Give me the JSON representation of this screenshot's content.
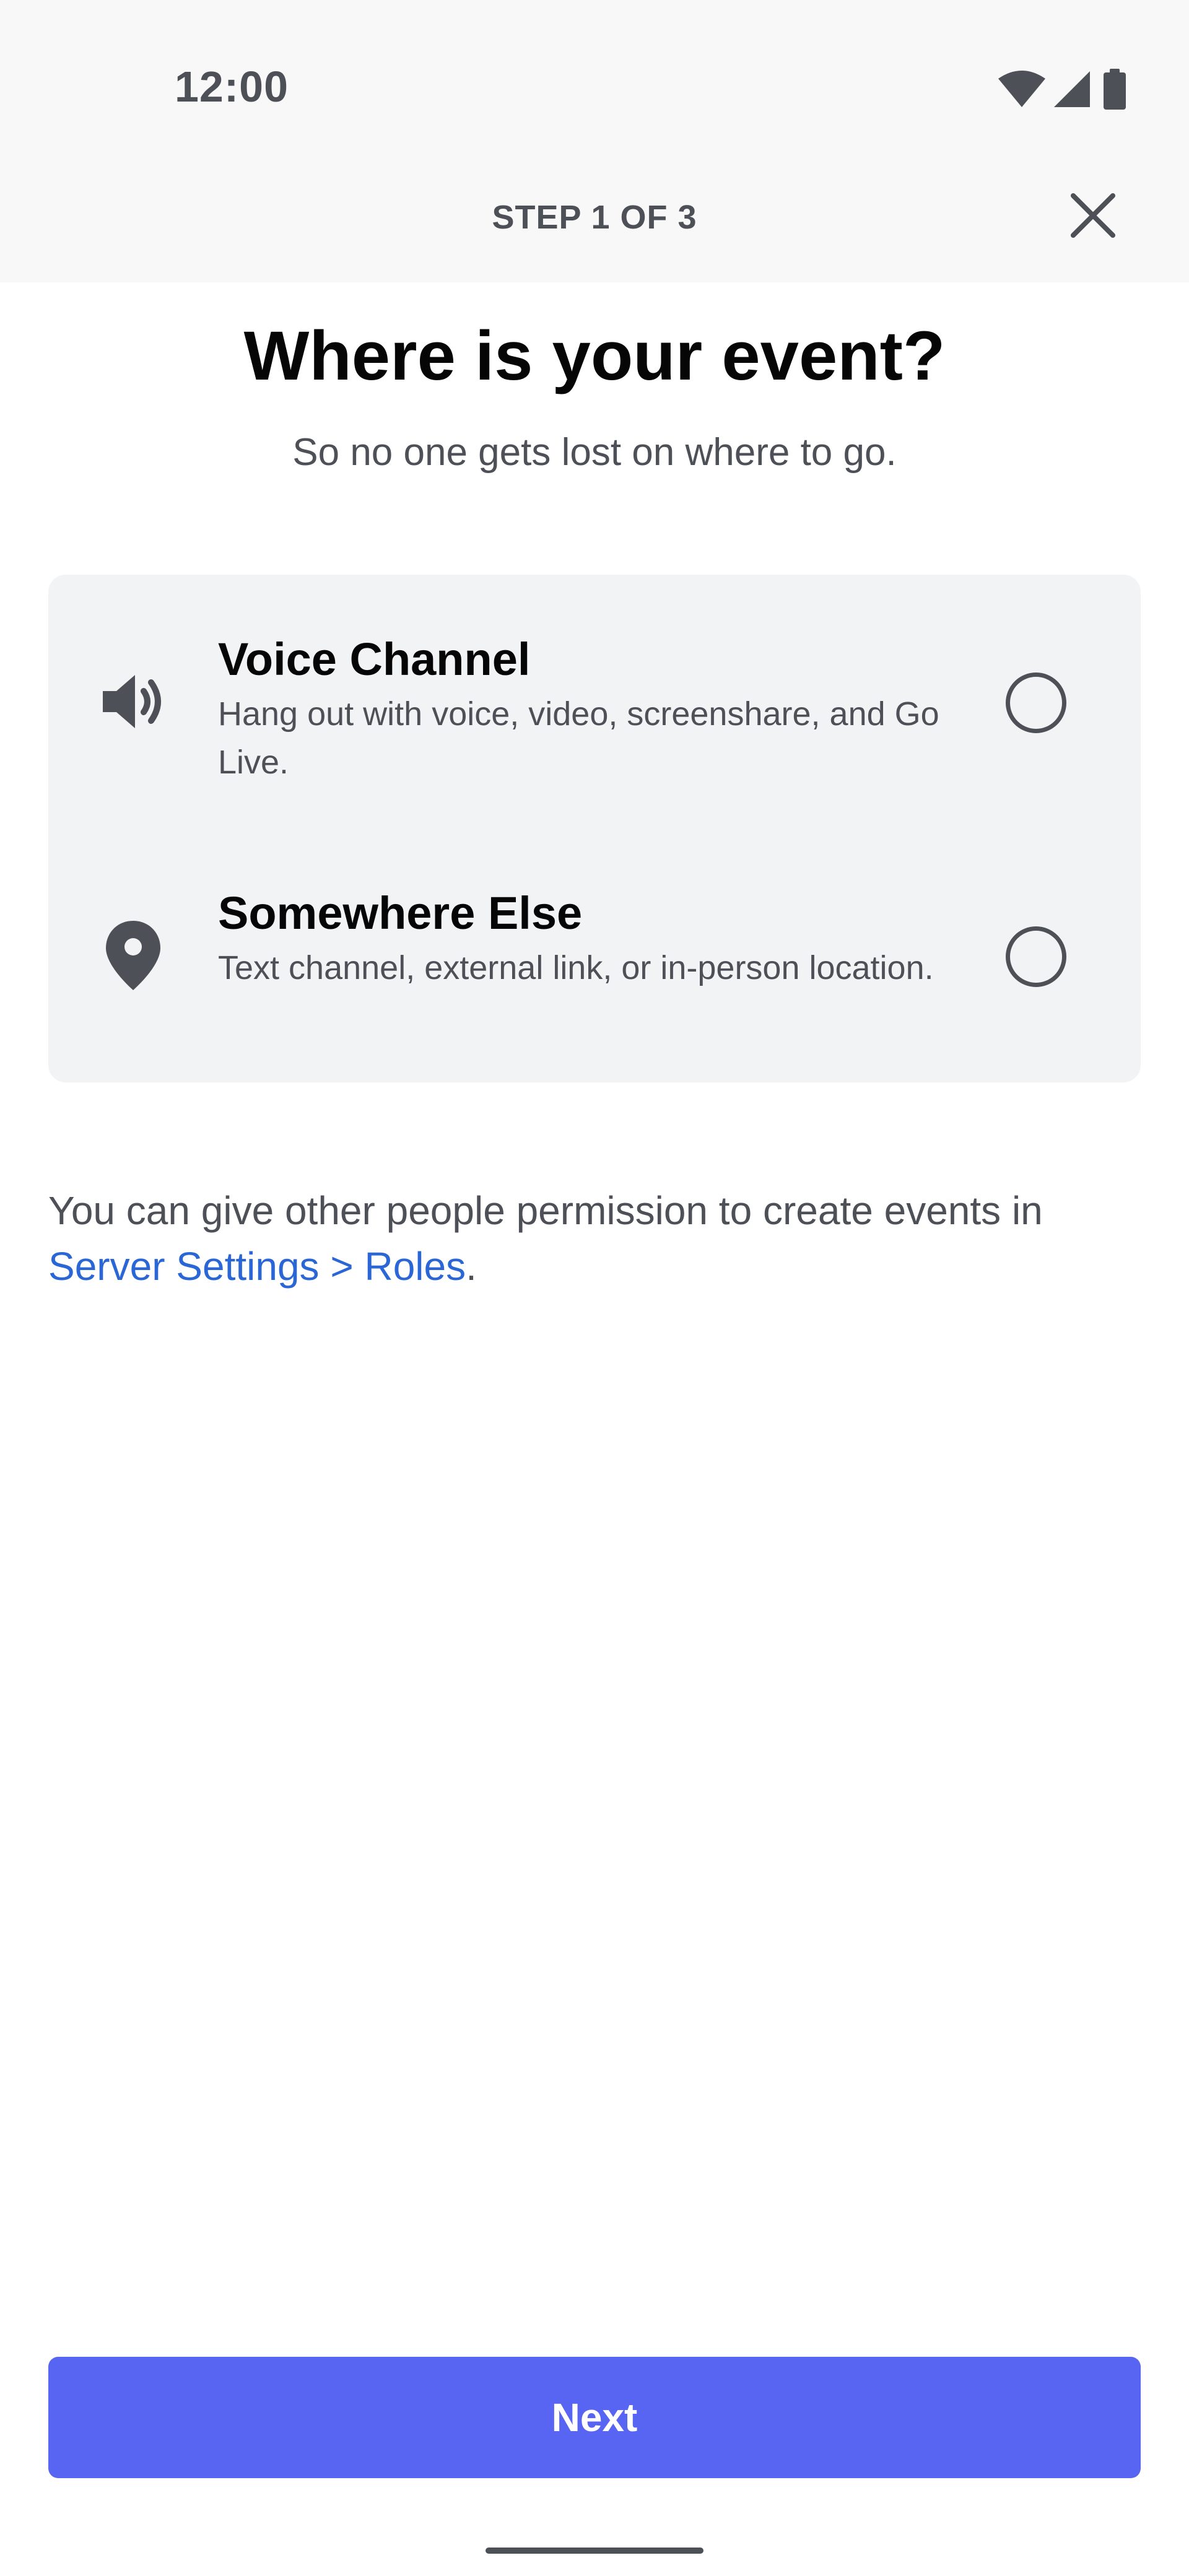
{
  "status_bar": {
    "time": "12:00",
    "icons": [
      "wifi-icon",
      "cellular-signal-icon",
      "battery-icon"
    ]
  },
  "header": {
    "step_label": "STEP 1 OF 3",
    "close_icon": "close-icon"
  },
  "page": {
    "title": "Where is your event?",
    "subtitle": "So no one gets lost on where to go."
  },
  "options": [
    {
      "icon": "speaker-icon",
      "title": "Voice Channel",
      "description": "Hang out with voice, video, screenshare, and Go Live.",
      "selected": false
    },
    {
      "icon": "location-pin-icon",
      "title": "Somewhere Else",
      "description": "Text channel, external link, or in-person location.",
      "selected": false
    }
  ],
  "note": {
    "text": "You can give other people permission to create events in ",
    "link": "Server Settings > Roles",
    "suffix": "."
  },
  "footer": {
    "next_label": "Next"
  },
  "colors": {
    "accent": "#5865f2",
    "link": "#2a66d6",
    "card_bg": "#f2f3f5",
    "muted_text": "#4e5058"
  }
}
